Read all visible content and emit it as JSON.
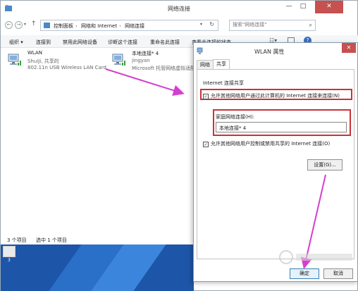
{
  "explorer": {
    "title": "网络连接",
    "controls": {
      "minimize": "—",
      "maximize": "□",
      "close": "✕"
    },
    "nav": {
      "back": "←",
      "forward": "→",
      "recent": "▾",
      "up": "↑"
    },
    "breadcrumb": [
      "控制面板",
      "网络和 Internet",
      "网络连接"
    ],
    "address_dropdown": "▾",
    "refresh": "↻",
    "search_placeholder": "搜索\"网络连接\"",
    "toolbar": {
      "organize": "组织 ▾",
      "connect": "连接到",
      "disable": "禁用此网络设备",
      "diagnose": "诊断这个连接",
      "rename": "重命名此连接",
      "status": "查看此连接的状态",
      "help": "?"
    },
    "adapters": [
      {
        "name": "WLAN",
        "network": "ShuiJi, 共享的",
        "device": "802.11n USB Wireless LAN Card"
      },
      {
        "name": "本地连接* 4",
        "network": "jingyan",
        "device": "Microsoft 托管网络虚拟适配"
      }
    ],
    "status": {
      "count": "3 个项目",
      "selected": "选中 1 个项目"
    },
    "desktop_icon_label": "3"
  },
  "dialog": {
    "title": "WLAN 属性",
    "close": "✕",
    "tabs": [
      "网络",
      "共享"
    ],
    "section_title": "Internet 连接共享",
    "allow_connect": "允许其他网络用户通过此计算机的 Internet 连接来连接(N)",
    "allow_connect_checked": true,
    "home_label": "家庭网络连接(H):",
    "home_value": "本地连接* 4",
    "allow_control": "允许其他网络用户控制或禁用共享的 Internet 连接(O)",
    "allow_control_checked": true,
    "settings_button": "设置(G)...",
    "ok": "确定",
    "cancel": "取消"
  },
  "colors": {
    "highlight": "#c9333a",
    "arrow": "#d43fcf",
    "desktop": "#1d55a8"
  },
  "icons": [
    "network-adapter-icon",
    "folder-icon",
    "search-icon",
    "help-icon",
    "check-icon"
  ]
}
